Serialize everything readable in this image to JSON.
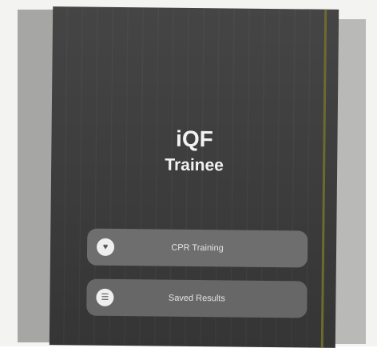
{
  "app": {
    "title": "iQF",
    "subtitle": "Trainee"
  },
  "menu": {
    "items": [
      {
        "label": "CPR Training",
        "icon": "heart-icon"
      },
      {
        "label": "Saved Results",
        "icon": "list-icon"
      }
    ]
  },
  "colors": {
    "screen_background": "#3e3e3e",
    "button_background": "#6e6e6e",
    "text": "#f2f2f2"
  }
}
